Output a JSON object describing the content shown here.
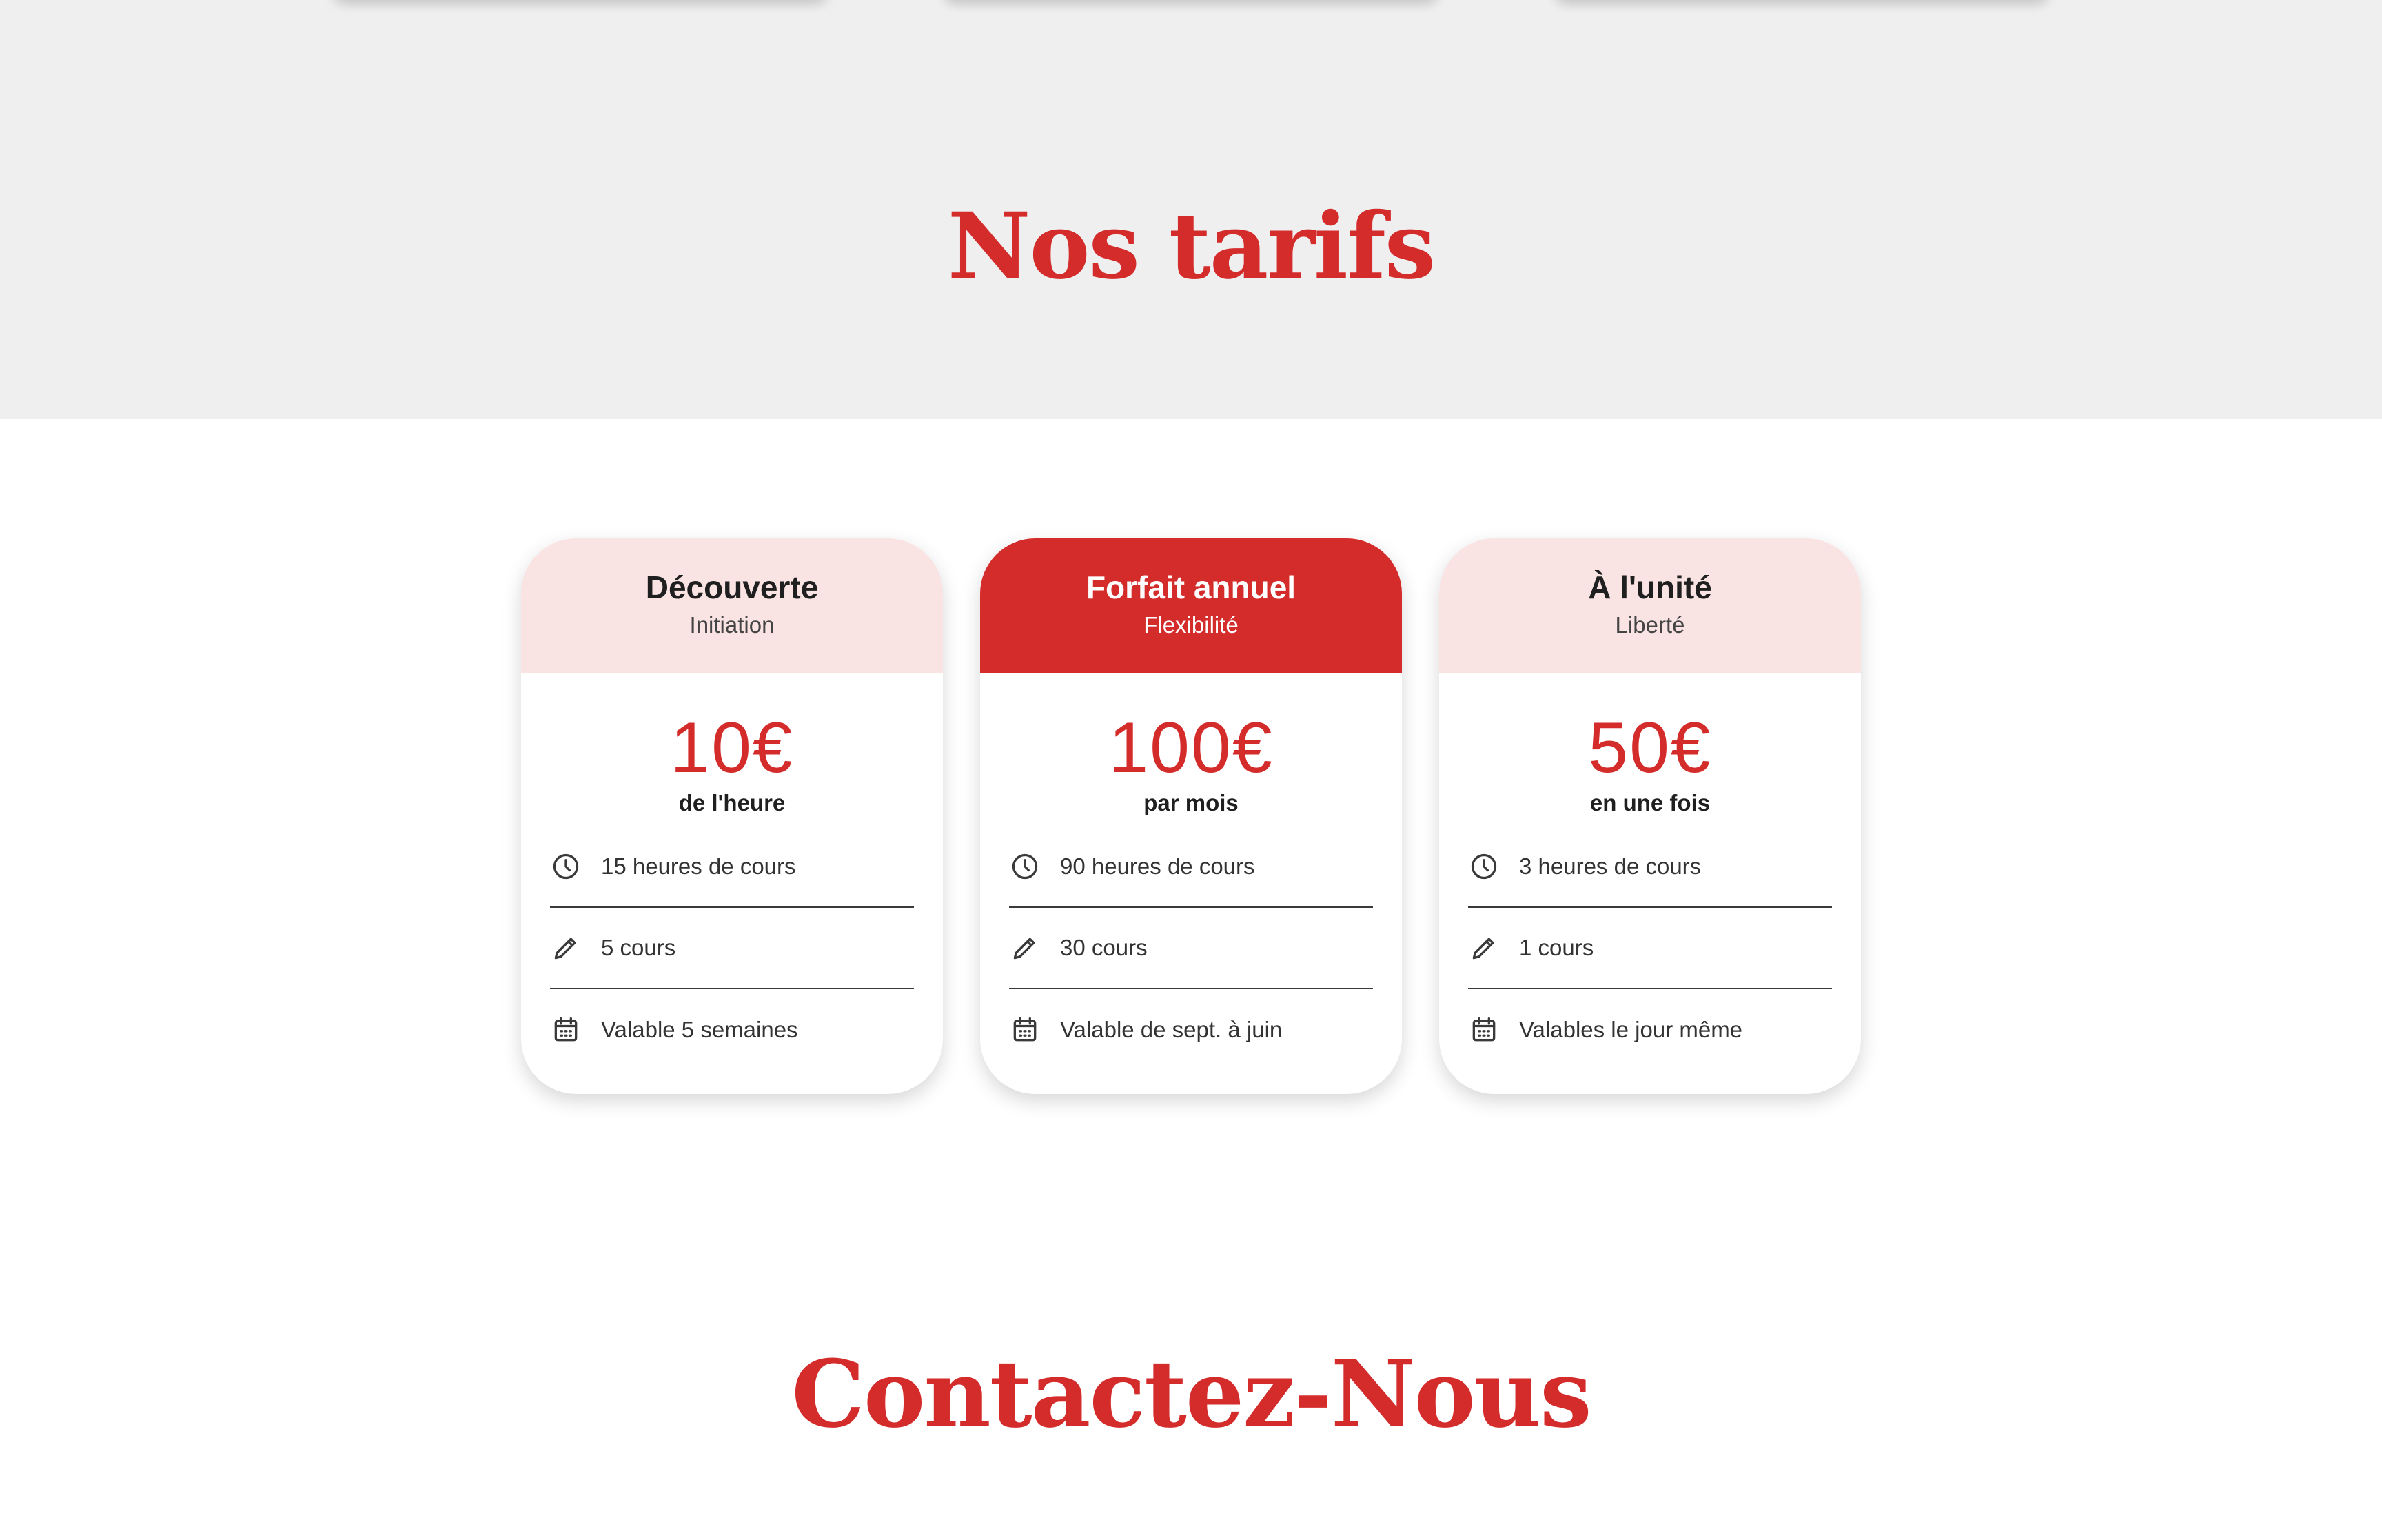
{
  "tarifs": {
    "title": "Nos tarifs"
  },
  "pricing": {
    "cards": [
      {
        "name": "Découverte",
        "subtitle": "Initiation",
        "price": "10€",
        "unit": "de l'heure",
        "featured": false,
        "features": [
          {
            "icon": "clock-icon",
            "text": "15 heures de cours"
          },
          {
            "icon": "pencil-icon",
            "text": "5 cours"
          },
          {
            "icon": "calendar-icon",
            "text": "Valable 5 semaines"
          }
        ]
      },
      {
        "name": "Forfait annuel",
        "subtitle": "Flexibilité",
        "price": "100€",
        "unit": "par mois",
        "featured": true,
        "features": [
          {
            "icon": "clock-icon",
            "text": "90 heures de cours"
          },
          {
            "icon": "pencil-icon",
            "text": "30 cours"
          },
          {
            "icon": "calendar-icon",
            "text": "Valable de sept. à juin"
          }
        ]
      },
      {
        "name": "À l'unité",
        "subtitle": "Liberté",
        "price": "50€",
        "unit": "en une fois",
        "featured": false,
        "features": [
          {
            "icon": "clock-icon",
            "text": "3 heures de cours"
          },
          {
            "icon": "pencil-icon",
            "text": "1 cours"
          },
          {
            "icon": "calendar-icon",
            "text": "Valables le jour même"
          }
        ]
      }
    ]
  },
  "contact": {
    "title": "Contactez-Nous"
  },
  "colors": {
    "accent": "#d42b2b",
    "header_light": "#fae3e3",
    "band_grey": "#efefef",
    "text_dark": "#1f1f1f"
  }
}
